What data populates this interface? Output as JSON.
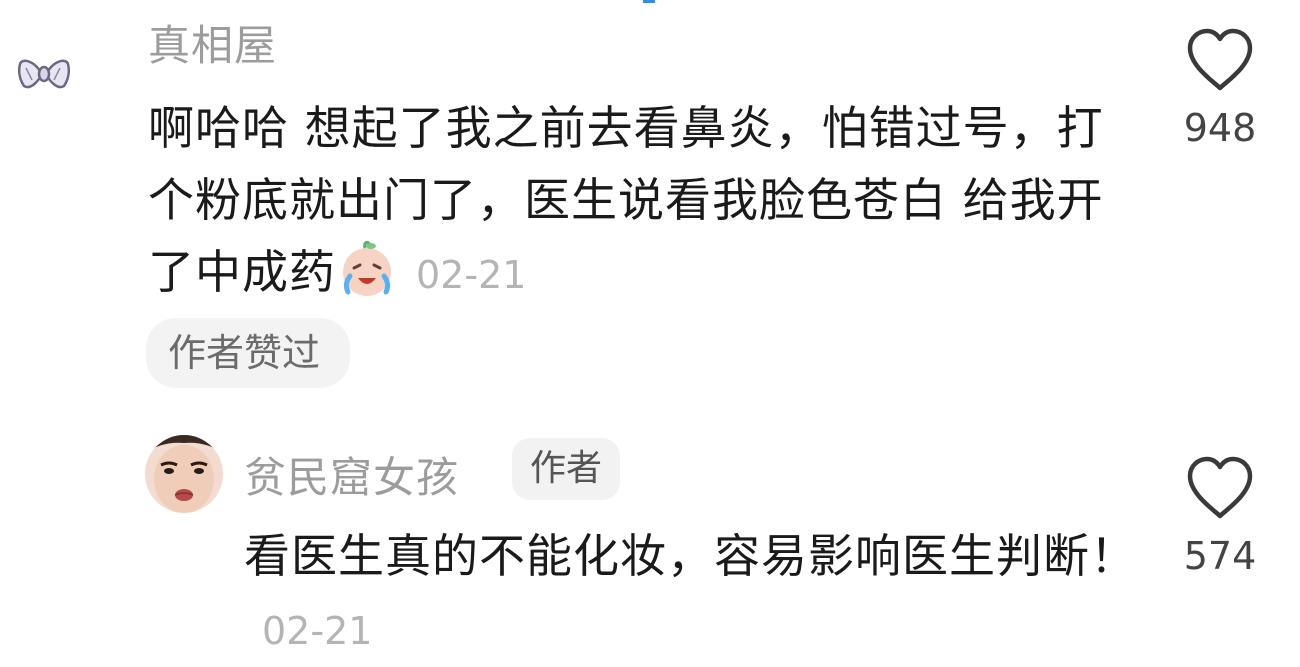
{
  "comments": [
    {
      "username": "真相屋",
      "text": "啊哈哈 想起了我之前去看鼻炎，怕错过号，打个粉底就出门了，医生说看我脸色苍白 给我开了中成药",
      "emoji": "crying-laughing-face-emoji",
      "timestamp": "02-21",
      "liked_tag": "作者赞过",
      "like_count": "948",
      "avatar": "bow-avatar"
    },
    {
      "username": "贫民窟女孩",
      "author_badge": "作者",
      "text": "看医生真的不能化妆，容易影响医生判断！",
      "timestamp": "02-21",
      "like_count": "574",
      "avatar": "face-avatar"
    }
  ],
  "colors": {
    "username": "#9c9c9c",
    "text": "#1a1a1a",
    "timestamp": "#b4b4b4",
    "tag_bg": "#f3f3f3",
    "accent": "#2f8fe8"
  }
}
